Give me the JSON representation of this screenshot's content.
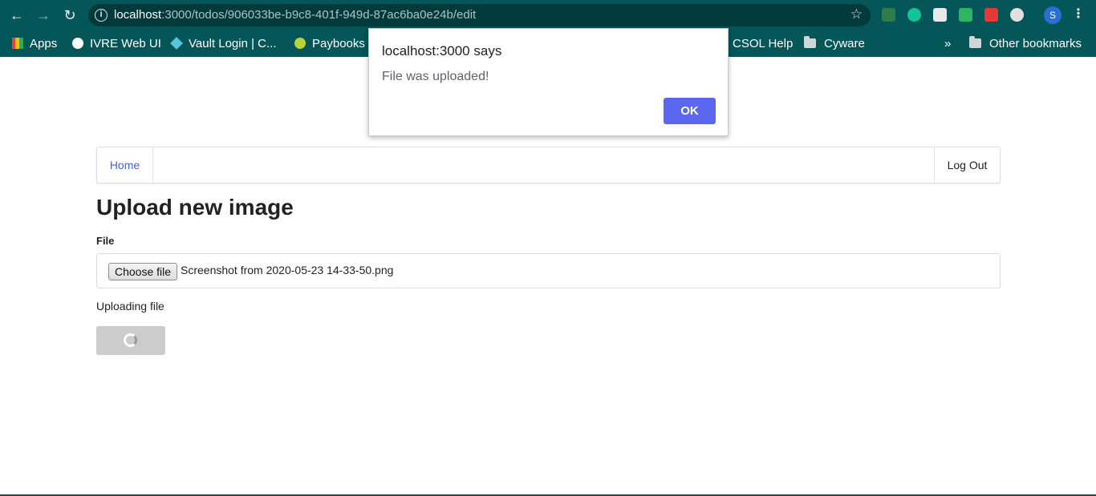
{
  "browser": {
    "url_host": "localhost",
    "url_rest": ":3000/todos/906033be-b9c8-401f-949d-87ac6ba0e24b/edit",
    "profile_initial": "S",
    "bookmarks": [
      {
        "label": "Apps"
      },
      {
        "label": "IVRE Web UI"
      },
      {
        "label": "Vault Login | C..."
      },
      {
        "label": "Paybooks"
      },
      {
        "label": "CSOL Help"
      },
      {
        "label": "Cyware"
      }
    ],
    "overflow": "»",
    "other_bookmarks": "Other bookmarks"
  },
  "navbar": {
    "home": "Home",
    "logout": "Log Out"
  },
  "page": {
    "title": "Upload new image",
    "file_label": "File",
    "choose_button": "Choose file",
    "file_name": "Screenshot from 2020-05-23 14-33-50.png",
    "status": "Uploading file"
  },
  "dialog": {
    "title": "localhost:3000 says",
    "message": "File was uploaded!",
    "ok": "OK"
  },
  "colors": {
    "chrome": "#045659",
    "accent": "#5b67ee",
    "link": "#4a63c8"
  }
}
